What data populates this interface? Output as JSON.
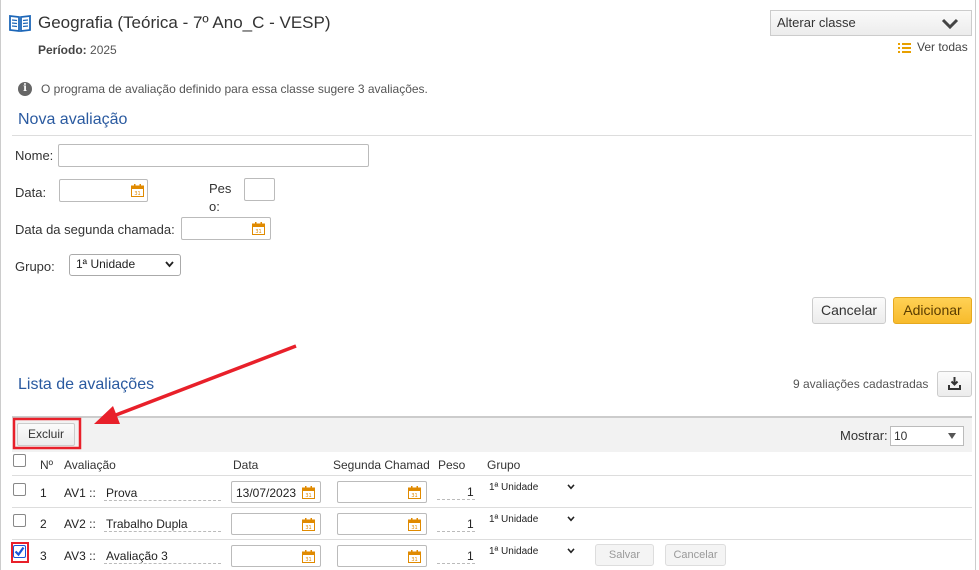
{
  "header": {
    "title": "Geografia (Teórica - 7º Ano_C - VESP)",
    "period_label": "Período:",
    "period_value": "2025",
    "class_select": "Alterar classe",
    "view_all": "Ver todas",
    "info": "O programa de avaliação definido para essa classe sugere 3 avaliações."
  },
  "form": {
    "title": "Nova avaliação",
    "name_label": "Nome:",
    "date_label": "Data:",
    "weight_label_1": "Pes",
    "weight_label_2": "o:",
    "second_call_label": "Data da segunda chamada:",
    "group_label": "Grupo:",
    "group_value": "1ª Unidade",
    "cancel": "Cancelar",
    "add": "Adicionar"
  },
  "list": {
    "title": "Lista de avaliações",
    "count": "9 avaliações cadastradas",
    "delete": "Excluir",
    "show_label": "Mostrar:",
    "show_value": "10",
    "columns": [
      "Nº",
      "Avaliação",
      "Data",
      "Segunda Chamad",
      "Peso",
      "Grupo"
    ],
    "rows": [
      {
        "n": "1",
        "code": "AV1 ::",
        "name": "Prova",
        "date": "13/07/2023",
        "weight": "1",
        "group": "1ª Unidade",
        "checked": false
      },
      {
        "n": "2",
        "code": "AV2 ::",
        "name": "Trabalho Dupla",
        "date": "",
        "weight": "1",
        "group": "1ª Unidade",
        "checked": false
      },
      {
        "n": "3",
        "code": "AV3 ::",
        "name": "Avaliação 3",
        "date": "",
        "weight": "1",
        "group": "1ª Unidade",
        "checked": true,
        "save": "Salvar",
        "cancel": "Cancelar"
      }
    ]
  },
  "colors": {
    "accent_blue": "#2a5aa0",
    "add_button": "#f7bb2c",
    "annotation_red": "#e8202a",
    "icon_orange": "#e08a00",
    "checkbox_blue": "#1a56d8"
  },
  "icons": {
    "book": "book-icon",
    "calendar": "calendar-icon",
    "list": "list-icon",
    "export": "download-icon",
    "info": "info-icon"
  }
}
